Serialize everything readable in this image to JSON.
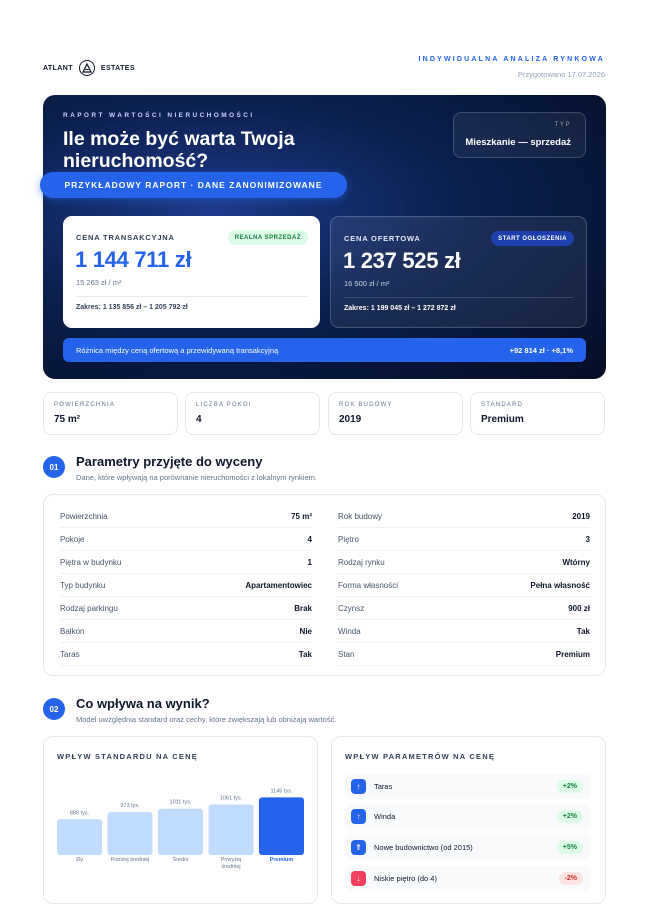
{
  "header": {
    "logo_left": "ATLANT",
    "logo_right": "ESTATES",
    "logo_icon": "triangle-a-icon",
    "report_kind": "INDYWIDUALNA ANALIZA RYNKOWA",
    "prepared": "Przygotowano 17.07.2026"
  },
  "hero": {
    "eyebrow": "RAPORT WARTOŚCI NIERUCHOMOŚCI",
    "title": "Ile może być warta Twoja nieruchomość?",
    "type_label": "TYP",
    "type_value": "Mieszkanie — sprzedaż",
    "banner": "PRZYKŁADOWY RAPORT · DANE ZANONIMIZOWANE",
    "transaction": {
      "label": "CENA TRANSAKCYJNA",
      "badge": "REALNA SPRZEDAŻ",
      "value": "1 144 711 zł",
      "per_m2": "15 263 zł / m²",
      "range": "Zakres: 1 135 856 zł – 1 205 792 zł"
    },
    "offer": {
      "label": "CENA OFERTOWA",
      "badge": "START OGŁOSZENIA",
      "value": "1 237 525 zł",
      "per_m2": "16 500 zł / m²",
      "range": "Zakres: 1 199 045 zł – 1 272 872 zł"
    },
    "diff_label": "Różnica między ceną ofertową a przewidywaną transakcyjną",
    "diff_value": "+92 814 zł · +8,1%"
  },
  "stats": [
    {
      "label": "POWIERZCHNIA",
      "value": "75 m²"
    },
    {
      "label": "LICZBA POKOI",
      "value": "4"
    },
    {
      "label": "ROK BUDOWY",
      "value": "2019"
    },
    {
      "label": "STANDARD",
      "value": "Premium"
    }
  ],
  "section1": {
    "num": "01",
    "title": "Parametry przyjęte do wyceny",
    "subtitle": "Dane, które wpływają na porównanie nieruchomości z lokalnym rynkiem."
  },
  "params_left": [
    {
      "k": "Powierzchnia",
      "v": "75 m²"
    },
    {
      "k": "Pokoje",
      "v": "4"
    },
    {
      "k": "Piętra w budynku",
      "v": "1"
    },
    {
      "k": "Typ budynku",
      "v": "Apartamentowiec"
    },
    {
      "k": "Rodzaj parkingu",
      "v": "Brak"
    },
    {
      "k": "Balkon",
      "v": "Nie"
    },
    {
      "k": "Taras",
      "v": "Tak"
    }
  ],
  "params_right": [
    {
      "k": "Rok budowy",
      "v": "2019"
    },
    {
      "k": "Piętro",
      "v": "3"
    },
    {
      "k": "Rodzaj rynku",
      "v": "Wtórny"
    },
    {
      "k": "Forma własności",
      "v": "Pełna własność"
    },
    {
      "k": "Czynsz",
      "v": "900 zł"
    },
    {
      "k": "Winda",
      "v": "Tak"
    },
    {
      "k": "Stan",
      "v": "Premium"
    }
  ],
  "section2": {
    "num": "02",
    "title": "Co wpływa na wynik?",
    "subtitle": "Model uwzględnia standard oraz cechy, które zwiększają lub obniżają wartość."
  },
  "standard_card_title": "WPŁYW STANDARDU NA CENĘ",
  "chart_data": {
    "type": "bar",
    "title": "WPŁYW STANDARDU NA CENĘ",
    "categories": [
      "Zły",
      "Poniżej średniej",
      "Średni",
      "Powyżej średniej",
      "Premium"
    ],
    "values": [
      886,
      973,
      1011,
      1061,
      1145
    ],
    "value_labels": [
      "886 tys.",
      "973 tys.",
      "1011 tys.",
      "1061 tys.",
      "1145 tys."
    ],
    "unit": "tys.",
    "highlight_index": 4,
    "colors": {
      "normal": "#bfdbfe",
      "highlight": "#2563eb"
    }
  },
  "params_card_title": "WPŁYW PARAMETRÓW NA CENĘ",
  "impacts": [
    {
      "label": "Taras",
      "value": "+2%",
      "icon": "arrow-up-icon",
      "positive": true
    },
    {
      "label": "Winda",
      "value": "+2%",
      "icon": "arrow-up-icon",
      "positive": true
    },
    {
      "label": "Nowe budownictwo (od 2015)",
      "value": "+5%",
      "icon": "double-arrow-up-icon",
      "positive": true
    },
    {
      "label": "Niskie piętro (do 4)",
      "value": "-2%",
      "icon": "arrow-down-icon",
      "positive": false
    }
  ]
}
